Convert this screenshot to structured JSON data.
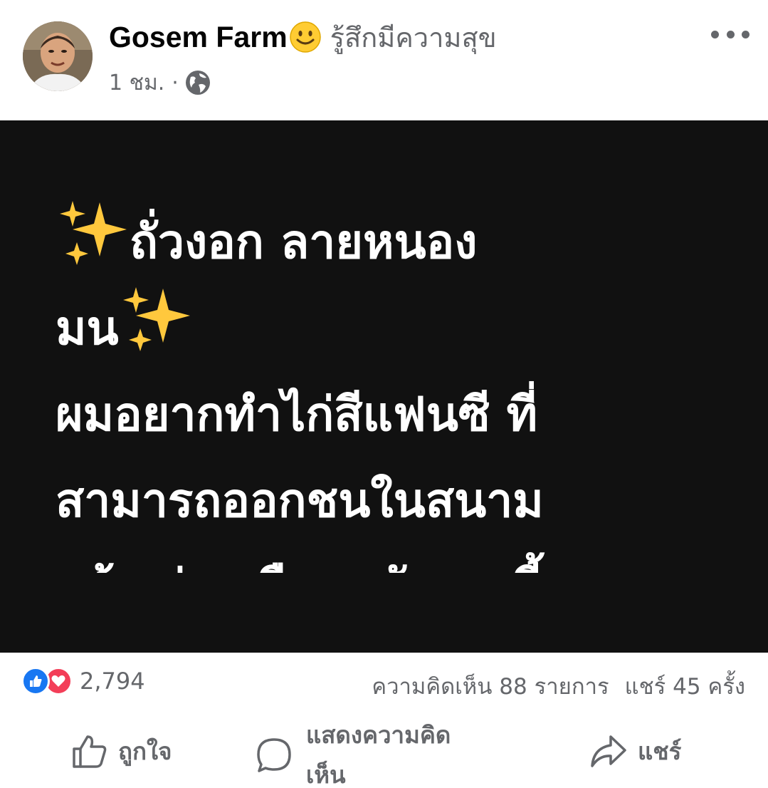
{
  "post": {
    "author": "Gosem Farm",
    "feeling": "รู้สึกมีความสุข",
    "time": "1 ชม.",
    "separator": "·",
    "icons": {
      "feeling": "slightly-smiling-face-icon",
      "privacy": "globe-icon",
      "more": "more-options-icon",
      "sparkles": "sparkles-icon"
    }
  },
  "card": {
    "background": "#111111",
    "lines": [
      "ถั่วงอก ลายหนอง",
      "มน",
      "ผมอยากทำไก่สีแฟนซี ที่",
      "สามารถออกชนในสนาม",
      "แล้วเก่งเหมือนหลังจากนี้"
    ]
  },
  "stats": {
    "reaction_count": "2,794",
    "comments": "ความคิดเห็น 88 รายการ",
    "shares": "แชร์ 45 ครั้ง",
    "colors": {
      "like": "#1877f2",
      "love": "#f33e58"
    }
  },
  "actions": {
    "like": "ถูกใจ",
    "comment": "แสดงความคิดเห็น",
    "share": "แชร์"
  }
}
